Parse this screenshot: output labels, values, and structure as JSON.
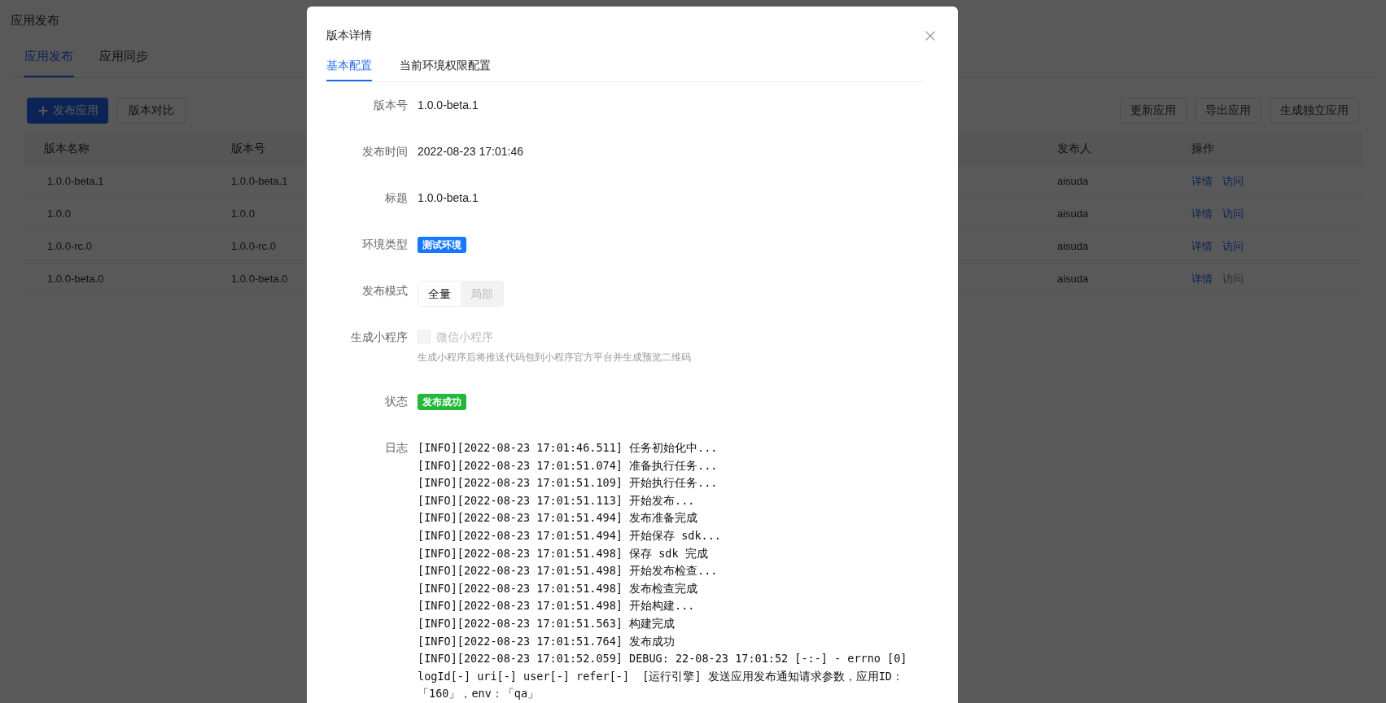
{
  "page": {
    "title": "应用发布",
    "tabs": [
      {
        "label": "应用发布",
        "selected": true
      },
      {
        "label": "应用同步",
        "selected": false
      }
    ],
    "left_buttons": [
      {
        "label": "发布应用",
        "kind": "primary"
      },
      {
        "label": "版本对比",
        "kind": "default"
      }
    ],
    "right_buttons": [
      "更新应用",
      "导出应用",
      "生成独立应用"
    ],
    "table": {
      "columns": [
        "版本名称",
        "版本号",
        "发布人",
        "操作"
      ],
      "rows": [
        {
          "name": "1.0.0-beta.1",
          "version": "1.0.0-beta.1",
          "publisher": "aisuda",
          "actions": [
            {
              "label": "详情",
              "disabled": false
            },
            {
              "label": "访问",
              "disabled": false
            }
          ]
        },
        {
          "name": "1.0.0",
          "version": "1.0.0",
          "publisher": "aisuda",
          "actions": [
            {
              "label": "详情",
              "disabled": false
            },
            {
              "label": "访问",
              "disabled": false
            }
          ]
        },
        {
          "name": "1.0.0-rc.0",
          "version": "1.0.0-rc.0",
          "publisher": "aisuda",
          "actions": [
            {
              "label": "详情",
              "disabled": false
            },
            {
              "label": "访问",
              "disabled": false
            }
          ]
        },
        {
          "name": "1.0.0-beta.0",
          "version": "1.0.0-beta.0",
          "publisher": "aisuda",
          "actions": [
            {
              "label": "详情",
              "disabled": false
            },
            {
              "label": "访问",
              "disabled": true
            }
          ]
        }
      ]
    }
  },
  "dialog": {
    "title": "版本详情",
    "tabs": [
      {
        "label": "基本配置",
        "selected": true
      },
      {
        "label": "当前环境权限配置",
        "selected": false
      }
    ],
    "fields": [
      {
        "kind": "text",
        "label": "版本号",
        "value": "1.0.0-beta.1"
      },
      {
        "kind": "text",
        "label": "发布时间",
        "value": "2022-08-23 17:01:46"
      },
      {
        "kind": "text",
        "label": "标题",
        "value": "1.0.0-beta.1"
      },
      {
        "kind": "tag",
        "label": "环境类型",
        "value": "测试环境",
        "color": "#1677ff"
      },
      {
        "kind": "segmented",
        "label": "发布模式",
        "options": [
          {
            "label": "全量",
            "selected": true
          },
          {
            "label": "局部",
            "selected": false
          }
        ]
      },
      {
        "kind": "checkbox",
        "label": "生成小程序",
        "value": "微信小程序",
        "checked": false,
        "disabled": true,
        "hint": "生成小程序后将推送代码包到小程序官方平台并生成预览二维码"
      },
      {
        "kind": "tag",
        "label": "状态",
        "value": "发布成功",
        "color": "#22b83a"
      },
      {
        "kind": "log",
        "label": "日志",
        "lines": [
          "[INFO][2022-08-23 17:01:46.511] 任务初始化中...",
          "[INFO][2022-08-23 17:01:51.074] 准备执行任务...",
          "[INFO][2022-08-23 17:01:51.109] 开始执行任务...",
          "[INFO][2022-08-23 17:01:51.113] 开始发布...",
          "[INFO][2022-08-23 17:01:51.494] 发布准备完成",
          "[INFO][2022-08-23 17:01:51.494] 开始保存 sdk...",
          "[INFO][2022-08-23 17:01:51.498] 保存 sdk 完成",
          "[INFO][2022-08-23 17:01:51.498] 开始发布检查...",
          "[INFO][2022-08-23 17:01:51.498] 发布检查完成",
          "[INFO][2022-08-23 17:01:51.498] 开始构建...",
          "[INFO][2022-08-23 17:01:51.563] 构建完成",
          "[INFO][2022-08-23 17:01:51.764] 发布成功",
          "[INFO][2022-08-23 17:01:52.059] DEBUG: 22-08-23 17:01:52 [-:-] - errno [0] logId[-] uri[-] user[-] refer[-]  [运行引擎] 发送应用发布通知请求参数，应用ID：「160」，env：「qa」"
        ]
      }
    ]
  }
}
